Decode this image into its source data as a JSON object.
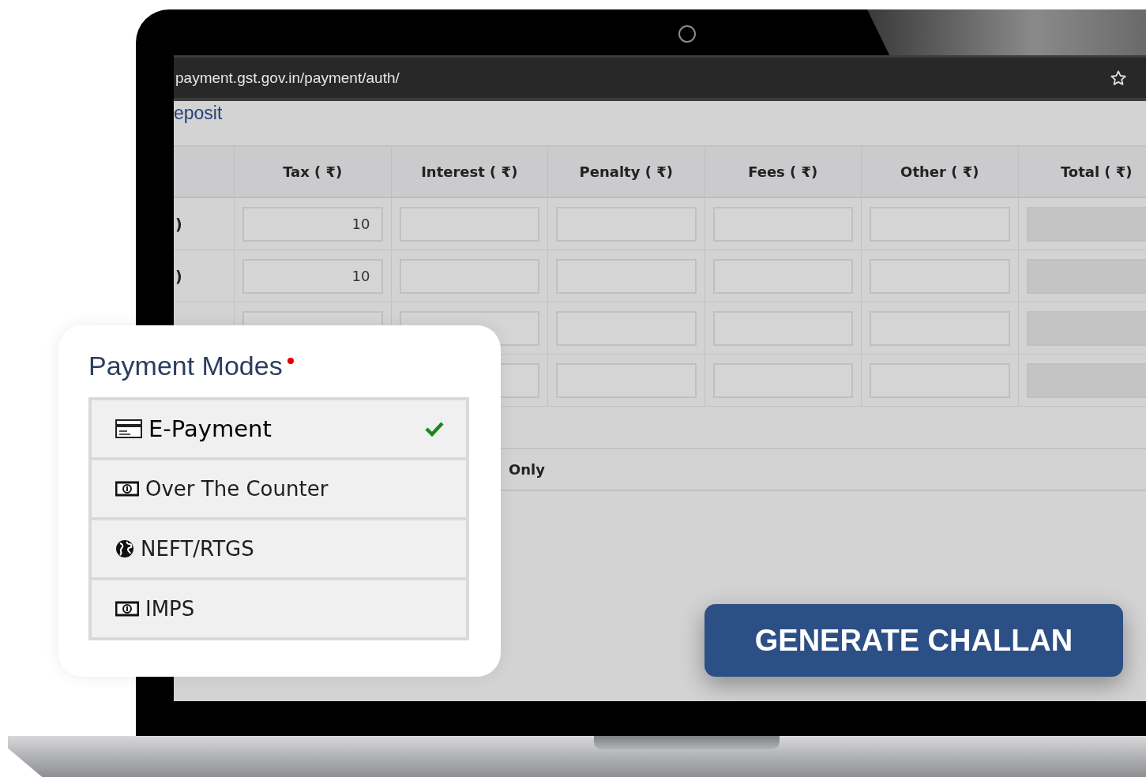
{
  "browser": {
    "url": "payment.gst.gov.in/payment/auth/"
  },
  "page": {
    "heading": "eposit",
    "table": {
      "columns": [
        "Tax ( ₹)",
        "Interest ( ₹)",
        "Penalty ( ₹)",
        "Fees ( ₹)",
        "Other ( ₹)",
        "Total ( ₹)"
      ],
      "rows": [
        {
          "label": ")",
          "tax": "10"
        },
        {
          "label": ")",
          "tax": "10"
        },
        {},
        {}
      ]
    },
    "note": "Only"
  },
  "payment_modes": {
    "title": "Payment Modes",
    "required": true,
    "options": [
      {
        "label": "E-Payment",
        "selected": true
      },
      {
        "label": "Over The Counter",
        "selected": false
      },
      {
        "label": "NEFT/RTGS",
        "selected": false
      },
      {
        "label": "IMPS",
        "selected": false
      }
    ]
  },
  "action": {
    "label": "GENERATE CHALLAN"
  }
}
